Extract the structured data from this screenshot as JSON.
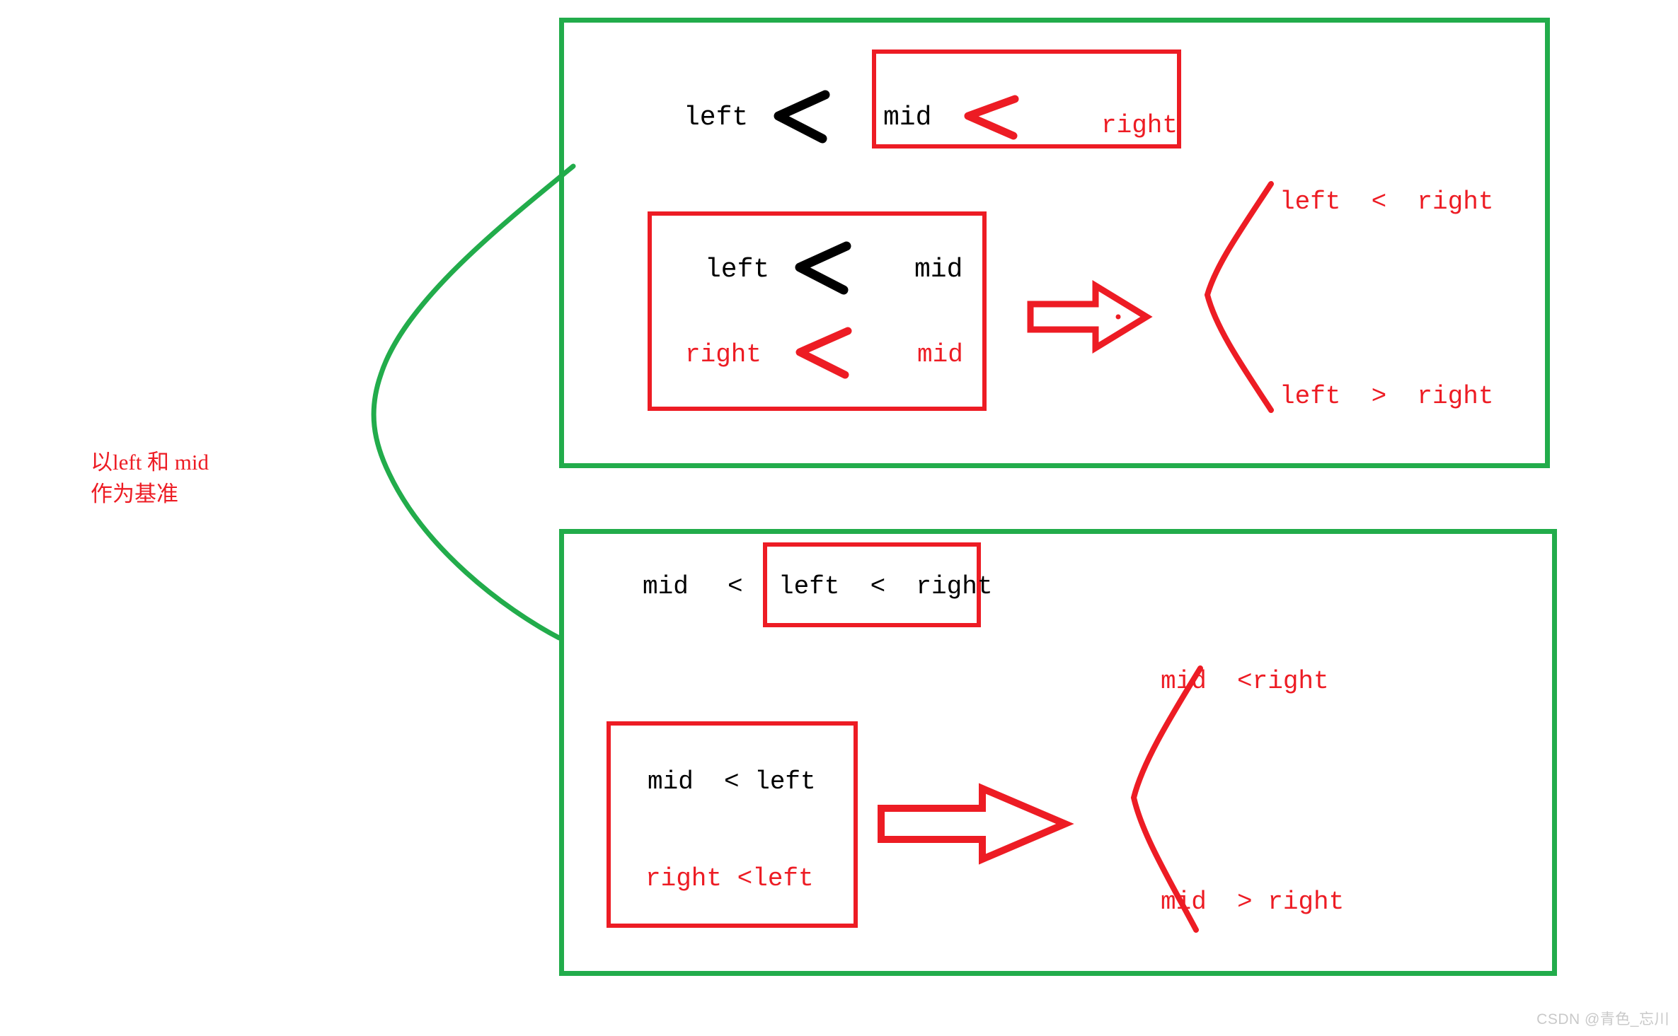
{
  "colors": {
    "green": "#22ac4b",
    "red": "#ed1c24",
    "black": "#000000",
    "watermark": "#c9c9c9"
  },
  "caption": {
    "line1": "以left 和 mid",
    "line2": "作为基准",
    "full": "以left 和 mid\n作为基准"
  },
  "groups": [
    {
      "id": "group-top",
      "premise": {
        "tokens": [
          "left",
          "<",
          "mid",
          "<",
          "right"
        ],
        "left": "left",
        "op1": "<",
        "mid": "mid",
        "op2": "<",
        "right": "right"
      },
      "case_box": {
        "row1": {
          "a": "left",
          "op": "<",
          "b": "mid"
        },
        "row2": {
          "a": "right",
          "op": "<",
          "b": "mid"
        }
      },
      "arrow": "thick-right-arrow",
      "outcomes": [
        {
          "text": "left < right",
          "a": "left",
          "op": "<",
          "b": "right"
        },
        {
          "text": "left > right",
          "a": "left",
          "op": ">",
          "b": "right"
        }
      ]
    },
    {
      "id": "group-bottom",
      "premise": {
        "tokens": [
          "mid",
          "<",
          "left",
          "<",
          "right"
        ],
        "left": "mid",
        "op1": "<",
        "mid": "left",
        "op2": "<",
        "right": "right"
      },
      "case_box": {
        "row1": {
          "a": "mid",
          "op": "<",
          "b": "left"
        },
        "row2": {
          "a": "right",
          "op": "<",
          "b": "left"
        }
      },
      "arrow": "thick-right-arrow",
      "outcomes": [
        {
          "text": "mid <right",
          "a": "mid",
          "op": "<",
          "b": "right"
        },
        {
          "text": "mid > right",
          "a": "mid",
          "op": ">",
          "b": "right"
        }
      ]
    }
  ],
  "labels": {
    "g1_premise_left": "left",
    "g1_premise_mid": "mid",
    "g1_premise_right": "right",
    "g1_case_r1_a": "left",
    "g1_case_r1_b": "mid",
    "g1_case_r2_a": "right",
    "g1_case_r2_b": "mid",
    "g1_out_top": "left  <  right",
    "g1_out_bottom": "left  >  right",
    "g2_premise_a": "mid",
    "g2_premise_op": "<",
    "g2_premise_b": "left  <  right",
    "g2_case_r1": "mid  < left",
    "g2_case_r2": "right <left",
    "g2_out_top": "mid  <right",
    "g2_out_bottom": "mid  > right"
  },
  "watermark": "CSDN @青色_忘川"
}
